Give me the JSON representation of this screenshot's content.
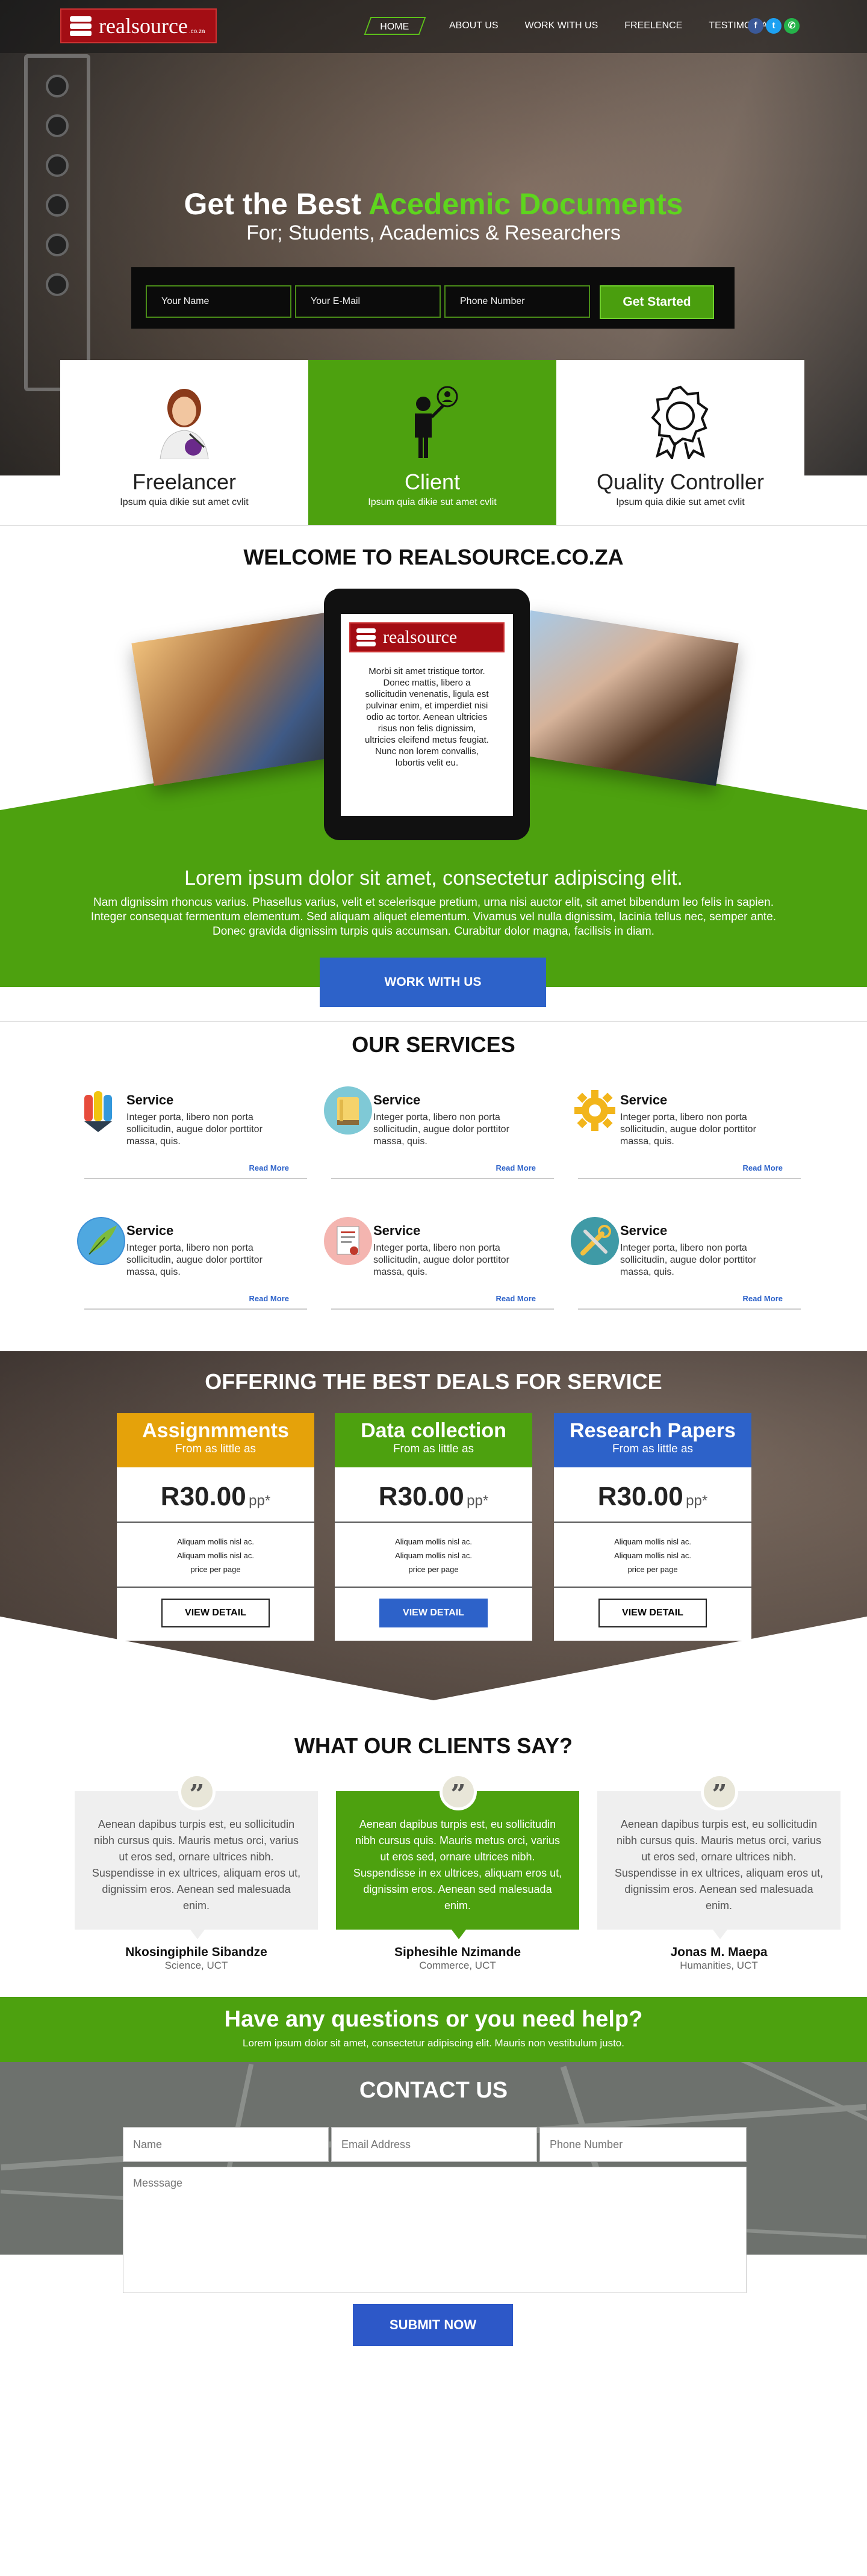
{
  "header": {
    "logo_text": "realsource",
    "logo_suffix": ".co.za",
    "nav": [
      {
        "label": "HOME",
        "active": true
      },
      {
        "label": "ABOUT US"
      },
      {
        "label": "WORK WITH US"
      },
      {
        "label": "FREELENCE"
      },
      {
        "label": "TESTIMONIALS"
      }
    ],
    "social": [
      "facebook-icon",
      "twitter-icon",
      "whatsapp-icon"
    ]
  },
  "hero": {
    "title_prefix": "Get the Best",
    "title_highlight": "Acedemic Documents",
    "subtitle": "For; Students, Academics & Researchers",
    "name_placeholder": "Your Name",
    "email_placeholder": "Your E-Mail",
    "phone_placeholder": "Phone Number",
    "cta": "Get Started"
  },
  "roles": [
    {
      "title": "Freelancer",
      "text": "Ipsum quia dikie sut amet cvlit",
      "icon": "freelancer-avatar-icon"
    },
    {
      "title": "Client",
      "text": "Ipsum quia dikie sut amet cvlit",
      "icon": "client-icon"
    },
    {
      "title": "Quality Controller",
      "text": "Ipsum quia dikie sut amet cvlit",
      "icon": "award-badge-icon"
    }
  ],
  "welcome": {
    "title": "WELCOME TO REALSOURCE.CO.ZA",
    "tablet_text": "Morbi sit amet tristique tortor. Donec mattis, libero a sollicitudin venenatis, ligula est pulvinar enim, et imperdiet nisi odio ac tortor. Aenean ultricies risus non felis dignissim, ultricies eleifend metus feugiat. Nunc non lorem convallis, lobortis velit eu.",
    "headline": "Lorem ipsum dolor sit amet, consectetur adipiscing elit.",
    "body": "Nam dignissim rhoncus varius. Phasellus varius, velit et scelerisque pretium, urna nisi auctor elit, sit amet bibendum leo felis in sapien. Integer consequat fermentum elementum. Sed aliquam aliquet elementum. Vivamus vel nulla dignissim, lacinia tellus nec, semper ante. Donec gravida dignissim turpis quis accumsan. Curabitur dolor magna, facilisis in diam.",
    "button": "WORK WITH US"
  },
  "services": {
    "title": "OUR SERVICES",
    "items": [
      {
        "title": "Service",
        "text": "Integer porta, libero non porta sollicitudin, augue dolor porttitor massa, quis.",
        "link": "Read More",
        "icon": "pencils-icon"
      },
      {
        "title": "Service",
        "text": "Integer porta, libero non porta sollicitudin, augue dolor porttitor massa, quis.",
        "link": "Read More",
        "icon": "book-icon"
      },
      {
        "title": "Service",
        "text": "Integer porta, libero non porta sollicitudin, augue dolor porttitor massa, quis.",
        "link": "Read More",
        "icon": "gear-icon"
      },
      {
        "title": "Service",
        "text": "Integer porta, libero non porta sollicitudin, augue dolor porttitor massa, quis.",
        "link": "Read More",
        "icon": "quill-icon"
      },
      {
        "title": "Service",
        "text": "Integer porta, libero non porta sollicitudin, augue dolor porttitor massa, quis.",
        "link": "Read More",
        "icon": "certificate-icon"
      },
      {
        "title": "Service",
        "text": "Integer porta, libero non porta sollicitudin, augue dolor porttitor massa, quis.",
        "link": "Read More",
        "icon": "tools-icon"
      }
    ]
  },
  "deals": {
    "title": "OFFERING THE BEST DEALS FOR SERVICE",
    "plans": [
      {
        "name": "Assignmments",
        "from": "From as little as",
        "price": "R30.00",
        "unit": "pp*",
        "f1": "Aliquam mollis nisl ac.",
        "f2": "Aliquam mollis nisl ac.",
        "f3": "price per page",
        "button": "VIEW DETAIL",
        "color": "#e5a20a"
      },
      {
        "name": "Data collection",
        "from": "From as little as",
        "price": "R30.00",
        "unit": "pp*",
        "f1": "Aliquam mollis nisl ac.",
        "f2": "Aliquam mollis nisl ac.",
        "f3": "price per page",
        "button": "VIEW DETAIL",
        "color": "#4da10f"
      },
      {
        "name": "Research Papers",
        "from": "From as little as",
        "price": "R30.00",
        "unit": "pp*",
        "f1": "Aliquam mollis nisl ac.",
        "f2": "Aliquam mollis nisl ac.",
        "f3": "price per page",
        "button": "VIEW DETAIL",
        "color": "#2d62c9"
      }
    ]
  },
  "testimonials": {
    "title": "WHAT OUR CLIENTS SAY?",
    "items": [
      {
        "quote": "Aenean dapibus turpis est, eu sollicitudin nibh cursus quis. Mauris metus orci, varius ut eros sed, ornare ultrices nibh. Suspendisse in ex ultrices, aliquam eros ut, dignissim eros. Aenean sed malesuada enim.",
        "name": "Nkosingiphile Sibandze",
        "role": "Science, UCT"
      },
      {
        "quote": "Aenean dapibus turpis est, eu sollicitudin nibh cursus quis. Mauris metus orci, varius ut eros sed, ornare ultrices nibh. Suspendisse in ex ultrices, aliquam eros ut, dignissim eros. Aenean sed malesuada enim.",
        "name": "Siphesihle Nzimande",
        "role": "Commerce, UCT"
      },
      {
        "quote": "Aenean dapibus turpis est, eu sollicitudin nibh cursus quis. Mauris metus orci, varius ut eros sed, ornare ultrices nibh. Suspendisse in ex ultrices, aliquam eros ut, dignissim eros. Aenean sed malesuada enim.",
        "name": "Jonas M. Maepa",
        "role": "Humanities, UCT"
      }
    ]
  },
  "help": {
    "title": "Have any questions or you need help?",
    "text": "Lorem ipsum dolor sit amet, consectetur adipiscing elit. Mauris non vestibulum justo."
  },
  "contact": {
    "title": "CONTACT US",
    "name_placeholder": "Name",
    "email_placeholder": "Email Address",
    "phone_placeholder": "Phone Number",
    "message_placeholder": "Messsage",
    "submit": "SUBMIT NOW"
  }
}
